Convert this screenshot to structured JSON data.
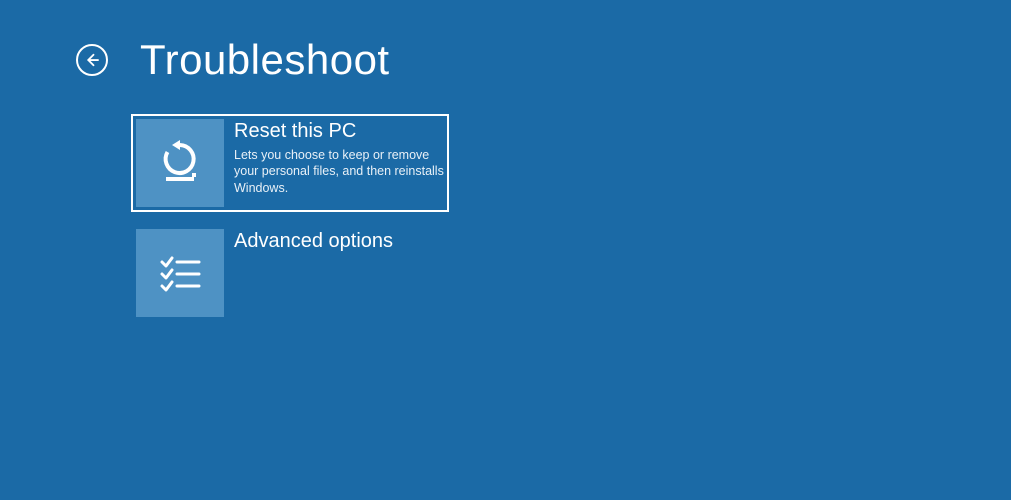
{
  "header": {
    "title": "Troubleshoot"
  },
  "options": [
    {
      "title": "Reset this PC",
      "description": "Lets you choose to keep or remove your personal files, and then reinstalls Windows."
    },
    {
      "title": "Advanced options",
      "description": ""
    }
  ]
}
